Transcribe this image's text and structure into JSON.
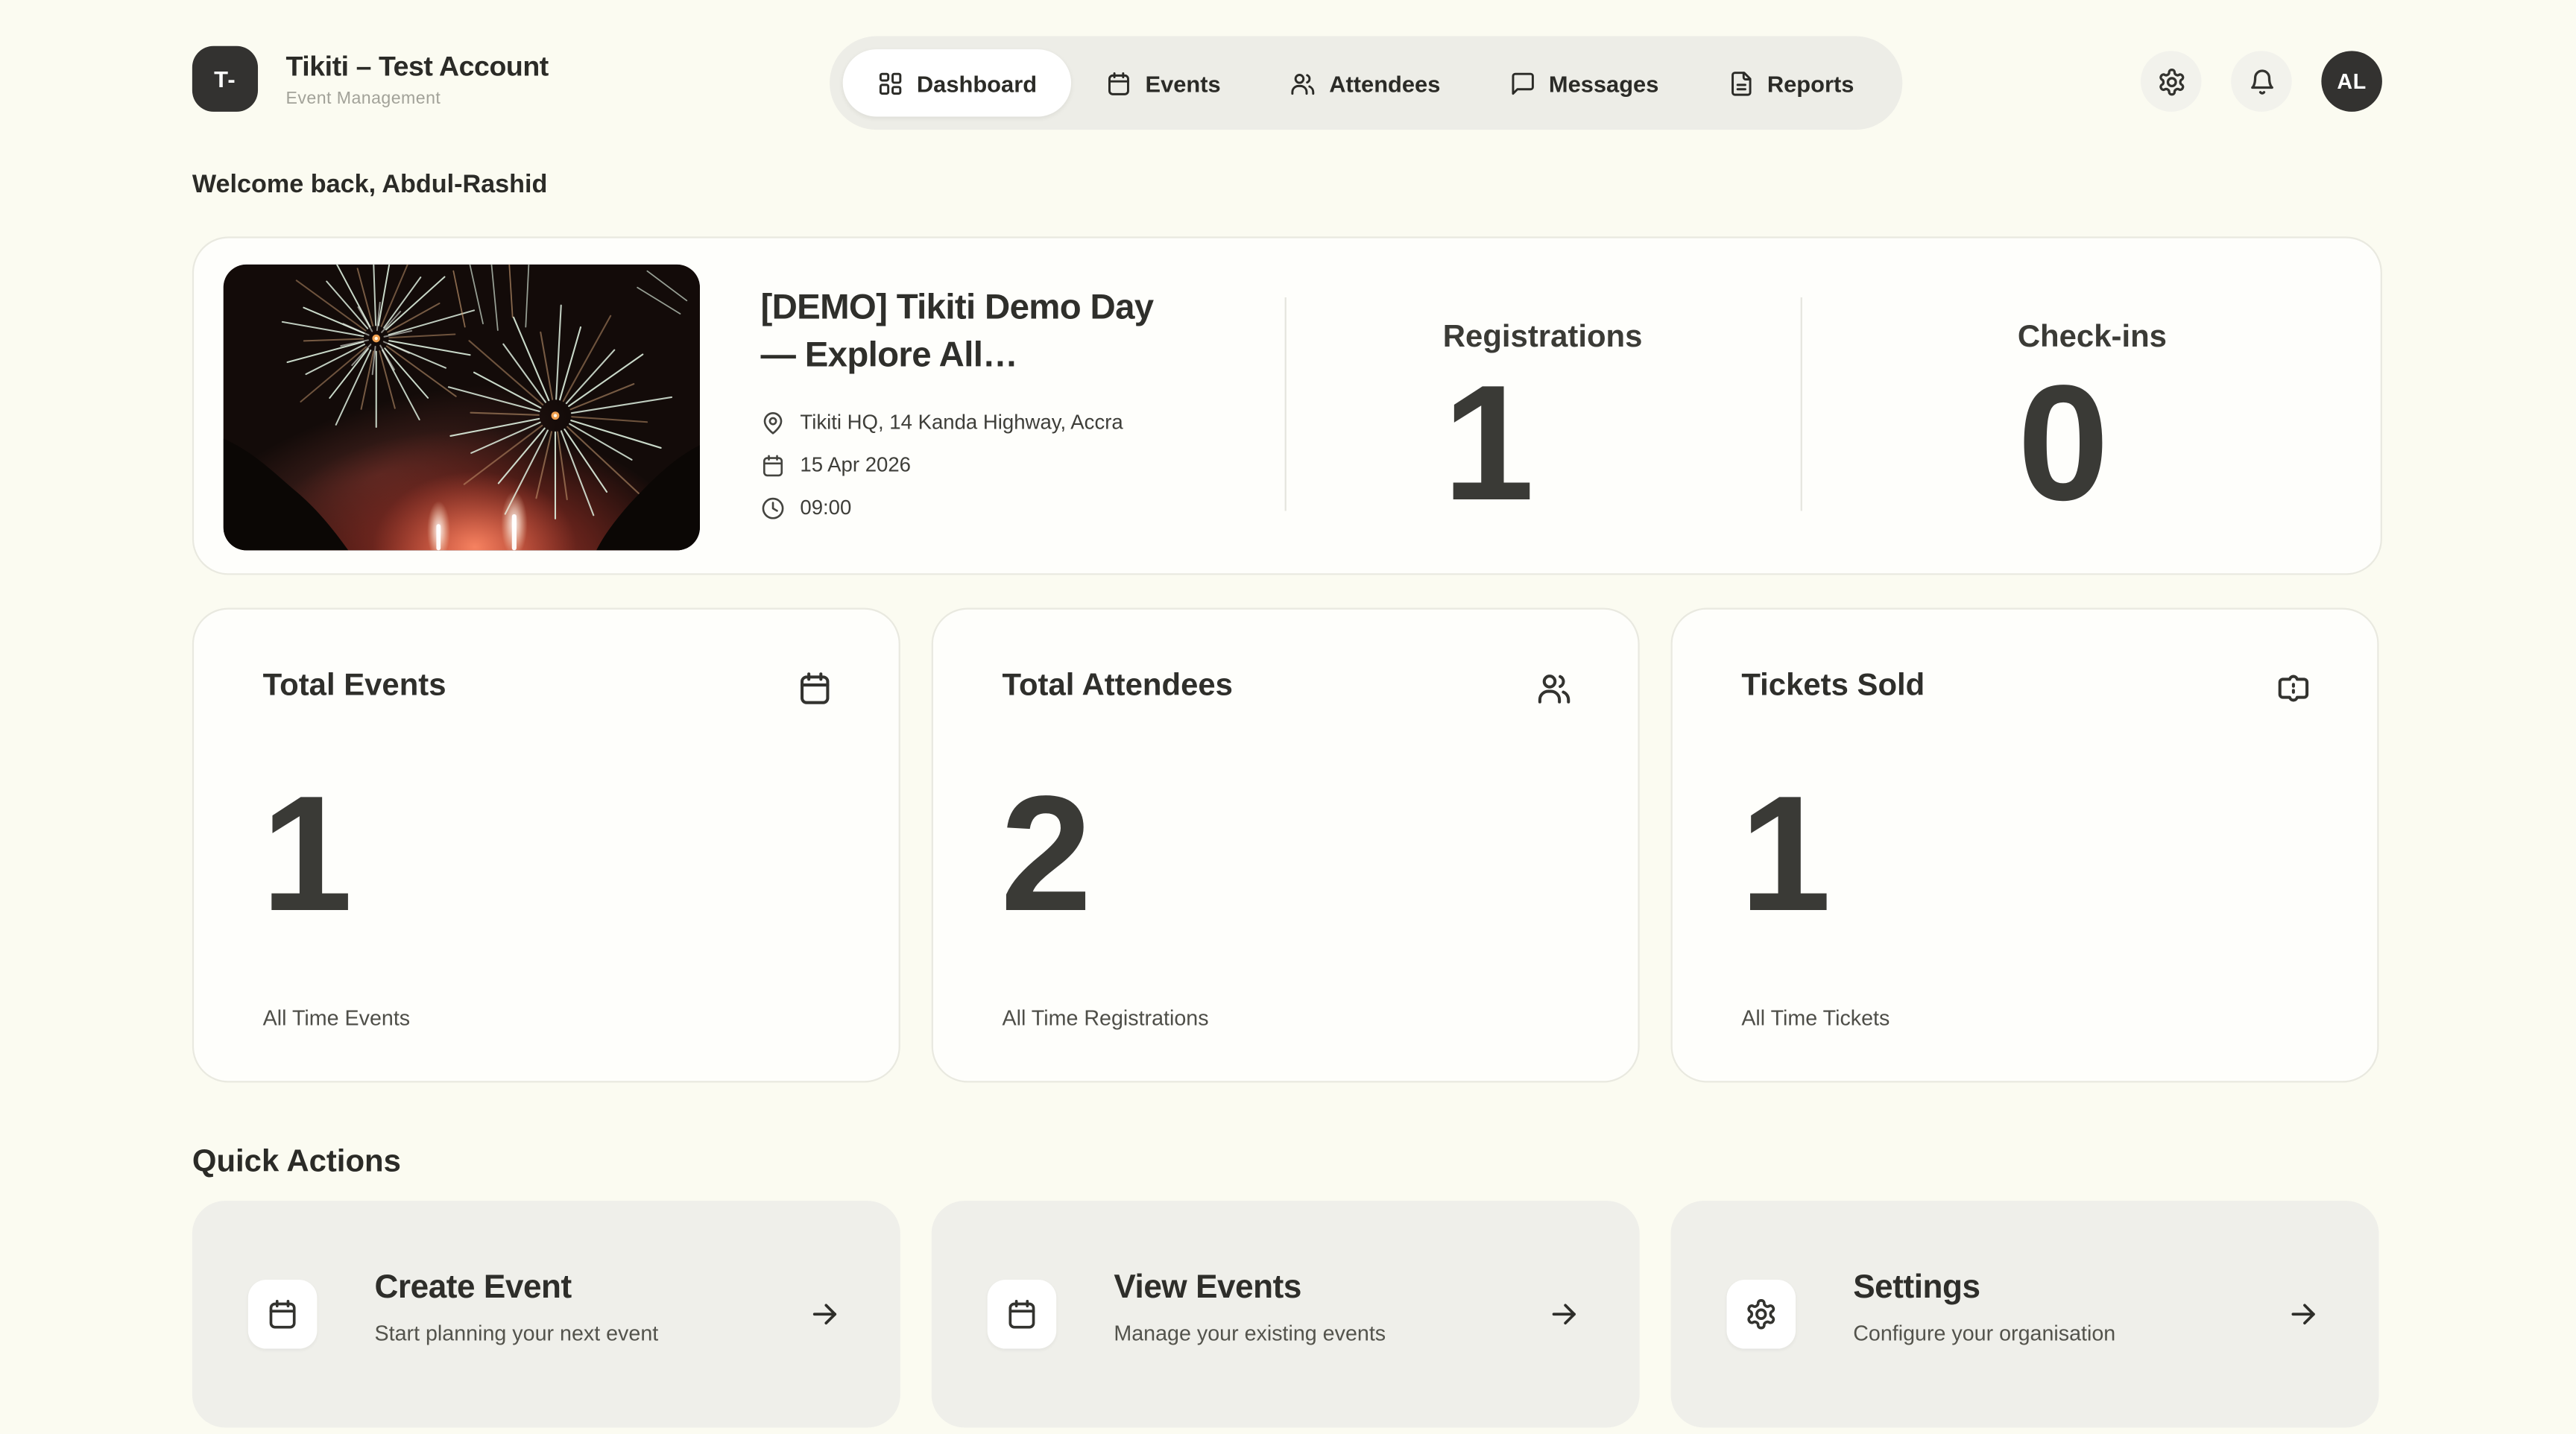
{
  "colors": {
    "page_bg": "#FBFBF1",
    "card_bg": "#FEFEFB",
    "card_border": "#E9E9E0",
    "nav_bg": "#EDEDE7",
    "active_tab_bg": "#FFFFFF",
    "dark_accent": "#333230",
    "action_card_bg": "#EFEFEA"
  },
  "header": {
    "logo_text": "T-",
    "org_name": "Tikiti – Test Account",
    "org_subtitle": "Event Management",
    "nav": [
      {
        "label": "Dashboard",
        "icon": "dashboard-grid-icon",
        "active": true
      },
      {
        "label": "Events",
        "icon": "calendar-icon",
        "active": false
      },
      {
        "label": "Attendees",
        "icon": "users-icon",
        "active": false
      },
      {
        "label": "Messages",
        "icon": "message-bubble-icon",
        "active": false
      },
      {
        "label": "Reports",
        "icon": "document-icon",
        "active": false
      }
    ],
    "actions": {
      "settings_icon": "gear-icon",
      "notifications_icon": "bell-icon"
    },
    "avatar_initials": "AL"
  },
  "welcome_text": "Welcome back, Abdul-Rashid",
  "featured_event": {
    "title": "[DEMO] Tikiti Demo Day — Explore All…",
    "location": "Tikiti HQ, 14 Kanda Highway, Accra",
    "date": "15 Apr 2026",
    "time": "09:00",
    "cover_image": "fireworks-night-photo",
    "stats": [
      {
        "label": "Registrations",
        "value": "1"
      },
      {
        "label": "Check-ins",
        "value": "0"
      }
    ]
  },
  "stat_cards": [
    {
      "title": "Total Events",
      "value": "1",
      "caption": "All Time Events",
      "icon": "calendar-icon"
    },
    {
      "title": "Total Attendees",
      "value": "2",
      "caption": "All Time Registrations",
      "icon": "users-icon"
    },
    {
      "title": "Tickets Sold",
      "value": "1",
      "caption": "All Time Tickets",
      "icon": "ticket-icon"
    }
  ],
  "quick_actions": {
    "heading": "Quick Actions",
    "items": [
      {
        "title": "Create Event",
        "subtitle": "Start planning your next event",
        "icon": "calendar-icon"
      },
      {
        "title": "View Events",
        "subtitle": "Manage your existing events",
        "icon": "calendar-icon"
      },
      {
        "title": "Settings",
        "subtitle": "Configure your organisation",
        "icon": "gear-icon"
      }
    ]
  }
}
